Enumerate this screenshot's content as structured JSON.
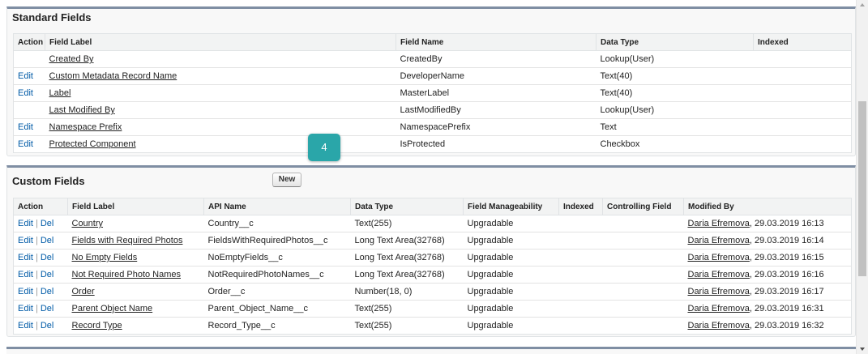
{
  "standard": {
    "title": "Standard Fields",
    "headers": [
      "Action",
      "Field Label",
      "Field Name",
      "Data Type",
      "Indexed"
    ],
    "rows": [
      {
        "action": "",
        "label": "Created By",
        "name": "CreatedBy",
        "type": "Lookup(User)"
      },
      {
        "action": "Edit",
        "label": "Custom Metadata Record Name",
        "name": "DeveloperName",
        "type": "Text(40)"
      },
      {
        "action": "Edit",
        "label": "Label",
        "name": "MasterLabel",
        "type": "Text(40)"
      },
      {
        "action": "",
        "label": "Last Modified By",
        "name": "LastModifiedBy",
        "type": "Lookup(User)"
      },
      {
        "action": "Edit",
        "label": "Namespace Prefix",
        "name": "NamespacePrefix",
        "type": "Text"
      },
      {
        "action": "Edit",
        "label": "Protected Component",
        "name": "IsProtected",
        "type": "Checkbox"
      }
    ]
  },
  "custom": {
    "title": "Custom Fields",
    "new_label": "New",
    "edit_label": "Edit",
    "del_label": "Del",
    "separator": "|",
    "headers": [
      "Action",
      "Field Label",
      "API Name",
      "Data Type",
      "Field Manageability",
      "Indexed",
      "Controlling Field",
      "Modified By"
    ],
    "rows": [
      {
        "label": "Country",
        "api": "Country__c",
        "type": "Text(255)",
        "manage": "Upgradable",
        "user": "Daria Efremova",
        "date": ", 29.03.2019 16:13"
      },
      {
        "label": "Fields with Required Photos",
        "api": "FieldsWithRequiredPhotos__c",
        "type": "Long Text Area(32768)",
        "manage": "Upgradable",
        "user": "Daria Efremova",
        "date": ", 29.03.2019 16:14"
      },
      {
        "label": "No Empty Fields",
        "api": "NoEmptyFields__c",
        "type": "Long Text Area(32768)",
        "manage": "Upgradable",
        "user": "Daria Efremova",
        "date": ", 29.03.2019 16:15"
      },
      {
        "label": "Not Required Photo Names",
        "api": "NotRequiredPhotoNames__c",
        "type": "Long Text Area(32768)",
        "manage": "Upgradable",
        "user": "Daria Efremova",
        "date": ", 29.03.2019 16:16"
      },
      {
        "label": "Order",
        "api": "Order__c",
        "type": "Number(18, 0)",
        "manage": "Upgradable",
        "user": "Daria Efremova",
        "date": ", 29.03.2019 16:17"
      },
      {
        "label": "Parent Object Name",
        "api": "Parent_Object_Name__c",
        "type": "Text(255)",
        "manage": "Upgradable",
        "user": "Daria Efremova",
        "date": ", 29.03.2019 16:31"
      },
      {
        "label": "Record Type",
        "api": "Record_Type__c",
        "type": "Text(255)",
        "manage": "Upgradable",
        "user": "Daria Efremova",
        "date": ", 29.03.2019 16:32"
      }
    ]
  },
  "callout": {
    "number": "4",
    "color": "#2aa6a9"
  },
  "colors": {
    "link": "#015ba7",
    "panel_border": "#7f8ea3"
  }
}
